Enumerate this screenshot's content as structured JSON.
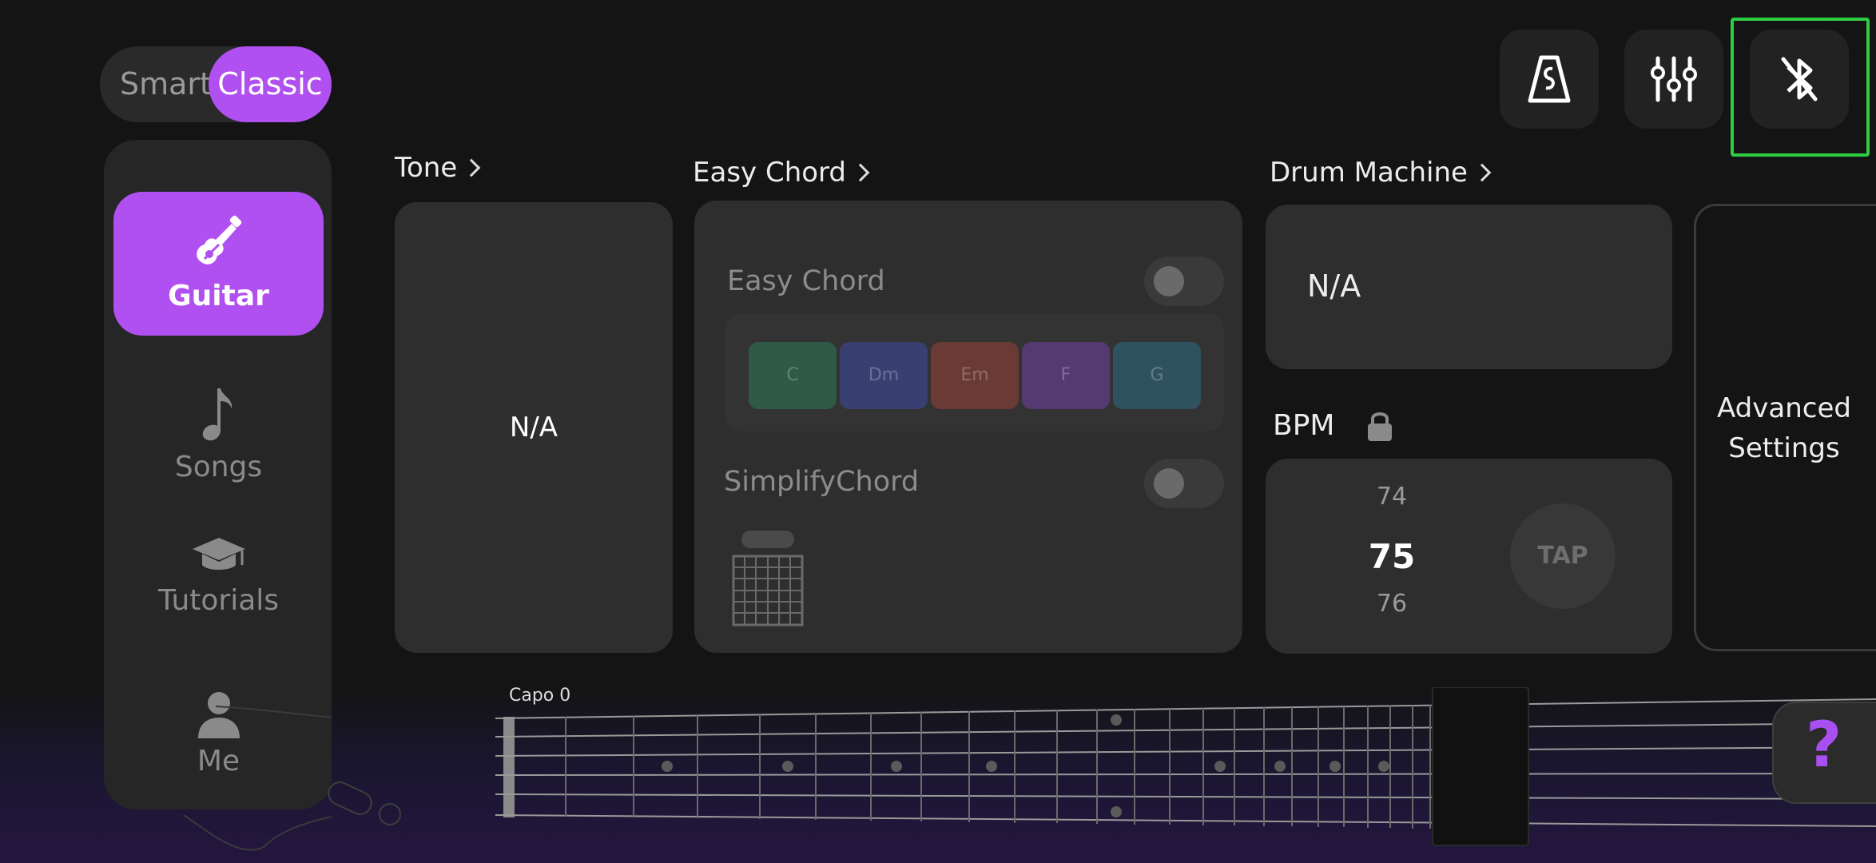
{
  "mode_toggle": {
    "smart": "Smart",
    "classic": "Classic"
  },
  "sidebar": {
    "items": [
      {
        "label": "Guitar",
        "icon": "guitar-icon",
        "active": true
      },
      {
        "label": "Songs",
        "icon": "music-note-icon",
        "active": false
      },
      {
        "label": "Tutorials",
        "icon": "graduation-cap-icon",
        "active": false
      },
      {
        "label": "Me",
        "icon": "person-icon",
        "active": false
      }
    ]
  },
  "toolbar": {
    "metronome_icon": "metronome-icon",
    "mixer_icon": "equalizer-sliders-icon",
    "bluetooth_icon": "bluetooth-off-icon"
  },
  "tone": {
    "title": "Tone",
    "value": "N/A"
  },
  "easy_chord": {
    "title": "Easy Chord",
    "toggle_label": "Easy Chord",
    "chords": [
      {
        "name": "C",
        "color": "#2f5a45"
      },
      {
        "name": "Dm",
        "color": "#3a3f72"
      },
      {
        "name": "Em",
        "color": "#6a3a35"
      },
      {
        "name": "F",
        "color": "#553a72"
      },
      {
        "name": "G",
        "color": "#2f5260"
      }
    ],
    "simplify_label": "SimplifyChord"
  },
  "drum_machine": {
    "title": "Drum Machine",
    "value": "N/A"
  },
  "bpm": {
    "label": "BPM",
    "prev": "74",
    "current": "75",
    "next": "76",
    "tap_label": "TAP"
  },
  "advanced": {
    "line1": "Advanced",
    "line2": "Settings"
  },
  "fretboard": {
    "capo_label": "Capo 0"
  },
  "help": {
    "label": "?"
  },
  "colors": {
    "accent": "#b050f0",
    "highlight_frame": "#2ecc40"
  }
}
